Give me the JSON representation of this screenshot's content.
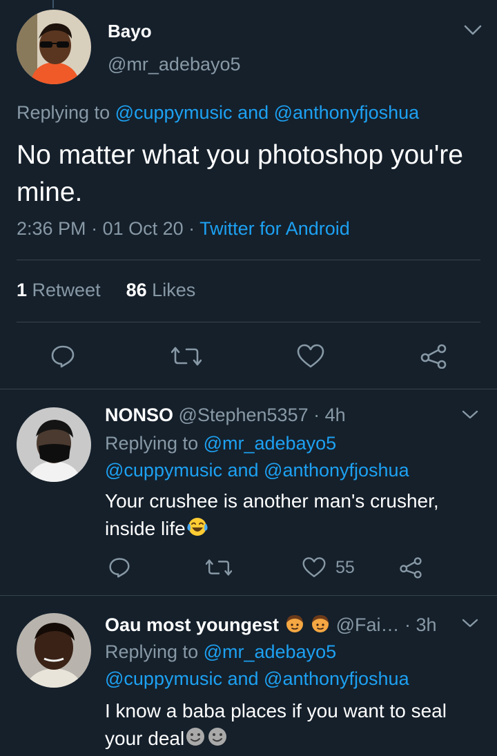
{
  "main_tweet": {
    "name": "Bayo",
    "handle": "@mr_adebayo5",
    "replying_prefix": "Replying to ",
    "replying_user1": "@cuppymusic",
    "replying_and": " and ",
    "replying_user2": "@anthonyfjoshua",
    "text": "No matter what you photoshop you're mine.",
    "time": "2:36 PM",
    "sep": " · ",
    "date": "01 Oct 20",
    "source": "Twitter for Android",
    "retweets_count": "1",
    "retweets_label": " Retweet",
    "likes_count": "86",
    "likes_label": " Likes"
  },
  "replies": [
    {
      "name": "NONSO",
      "handle": "@Stephen5357",
      "time": " · 4h",
      "replying_prefix": "Replying to ",
      "replying_user1": "@mr_adebayo5",
      "replying_user2": "@cuppymusic",
      "replying_and": " and ",
      "replying_user3": "@anthonyfjoshua",
      "text_line1": "Your crushee is another man's crusher,",
      "text_line2": "inside life",
      "like_count": "55",
      "emoji": "tears-of-joy"
    },
    {
      "name": "Oau most youngest",
      "handle": "@Fai…",
      "time": " · 3h",
      "replying_prefix": "Replying to ",
      "replying_user1": "@mr_adebayo5",
      "replying_user2": "@cuppymusic",
      "replying_and": " and ",
      "replying_user3": "@anthonyfjoshua",
      "text_line1": "I know a baba places if you want to seal",
      "text_line2": "your deal",
      "emoji": "smirk-face"
    }
  ],
  "colors": {
    "background": "#15202b",
    "secondary_text": "#8899a6",
    "link": "#1da1f2",
    "divider": "#38444d"
  }
}
